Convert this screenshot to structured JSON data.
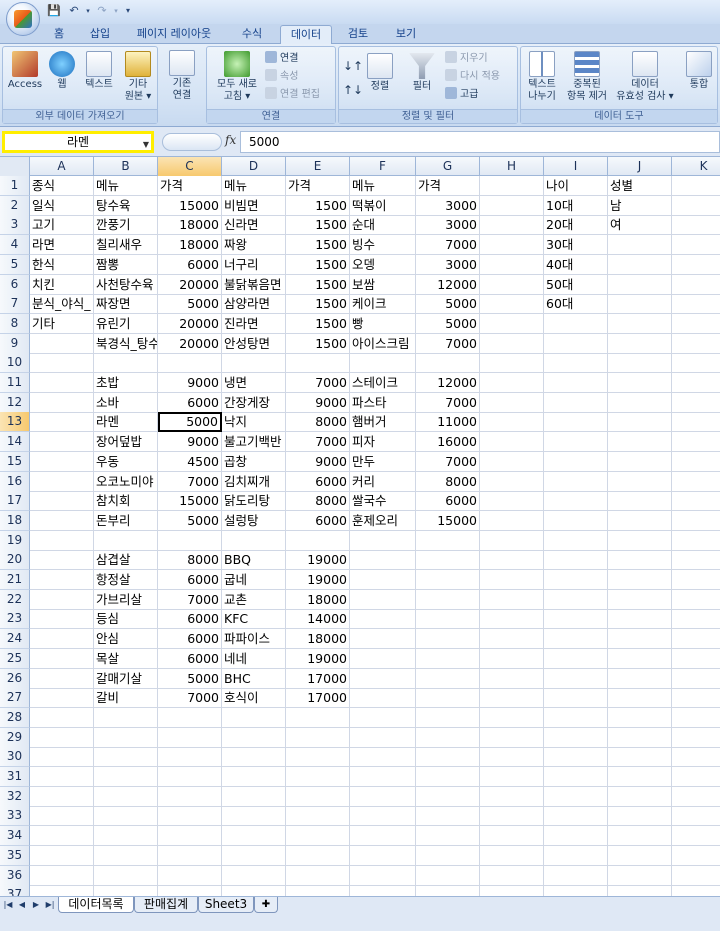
{
  "ribbon_tabs": [
    "홈",
    "삽입",
    "페이지 레이아웃",
    "수식",
    "데이터",
    "검토",
    "보기"
  ],
  "active_tab": "데이터",
  "groups": {
    "external": {
      "label": "외부 데이터 가져오기",
      "buttons": [
        "Access",
        "웹",
        "텍스트",
        "기타",
        "원본 ▾"
      ]
    },
    "existing": {
      "line1": "기존",
      "line2": "연결"
    },
    "connections": {
      "label": "연결",
      "refresh1": "모두 새로",
      "refresh2": "고침 ▾",
      "connect": "연결",
      "properties": "속성",
      "edit_links": "연결 편집"
    },
    "sortfilter": {
      "label": "정렬 및 필터",
      "sort": "정렬",
      "filter": "필터",
      "clear": "지우기",
      "reapply": "다시 적용",
      "advanced": "고급"
    },
    "datatools": {
      "label": "데이터 도구",
      "text1": "텍스트",
      "text2": "나누기",
      "dup1": "중복된",
      "dup2": "항목 제거",
      "valid1": "데이터",
      "valid2": "유효성 검사 ▾",
      "consolidate": "통합"
    }
  },
  "formula_bar": {
    "name_box": "라멘",
    "fx": "fx",
    "value": "5000"
  },
  "columns": [
    "A",
    "B",
    "C",
    "D",
    "E",
    "F",
    "G",
    "H",
    "I",
    "J",
    "K"
  ],
  "selected_cell": {
    "col": "C",
    "row": 13
  },
  "rows": [
    {
      "n": 1,
      "A": "종식",
      "B": "메뉴",
      "C": "가격",
      "D": "메뉴",
      "E": "가격",
      "F": "메뉴",
      "G": "가격",
      "I": "나이",
      "J": "성별"
    },
    {
      "n": 2,
      "A": "일식",
      "B": "탕수육",
      "C": "15000",
      "D": "비빔면",
      "E": "1500",
      "F": "떡볶이",
      "G": "3000",
      "I": "10대",
      "J": "남"
    },
    {
      "n": 3,
      "A": "고기",
      "B": "깐풍기",
      "C": "18000",
      "D": "신라면",
      "E": "1500",
      "F": "순대",
      "G": "3000",
      "I": "20대",
      "J": "여"
    },
    {
      "n": 4,
      "A": "라면",
      "B": "칠리새우",
      "C": "18000",
      "D": "짜왕",
      "E": "1500",
      "F": "빙수",
      "G": "7000",
      "I": "30대"
    },
    {
      "n": 5,
      "A": "한식",
      "B": "짬뽕",
      "C": "6000",
      "D": "너구리",
      "E": "1500",
      "F": "오뎅",
      "G": "3000",
      "I": "40대"
    },
    {
      "n": 6,
      "A": "치킨",
      "B": "사천탕수육",
      "C": "20000",
      "D": "불닭볶음면",
      "E": "1500",
      "F": "보쌈",
      "G": "12000",
      "I": "50대"
    },
    {
      "n": 7,
      "A": "분식_야식_",
      "B": "짜장면",
      "C": "5000",
      "D": "삼양라면",
      "E": "1500",
      "F": "케이크",
      "G": "5000",
      "I": "60대"
    },
    {
      "n": 8,
      "A": "기타",
      "B": "유린기",
      "C": "20000",
      "D": "진라면",
      "E": "1500",
      "F": "빵",
      "G": "5000"
    },
    {
      "n": 9,
      "B": "북경식_탕수",
      "C": "20000",
      "D": "안성탕면",
      "E": "1500",
      "F": "아이스크림",
      "G": "7000"
    },
    {
      "n": 10
    },
    {
      "n": 11,
      "B": "초밥",
      "C": "9000",
      "D": "냉면",
      "E": "7000",
      "F": "스테이크",
      "G": "12000"
    },
    {
      "n": 12,
      "B": "소바",
      "C": "6000",
      "D": "간장게장",
      "E": "9000",
      "F": "파스타",
      "G": "7000"
    },
    {
      "n": 13,
      "B": "라멘",
      "C": "5000",
      "D": "낙지",
      "E": "8000",
      "F": "햄버거",
      "G": "11000"
    },
    {
      "n": 14,
      "B": "장어덮밥",
      "C": "9000",
      "D": "불고기백반",
      "E": "7000",
      "F": "피자",
      "G": "16000"
    },
    {
      "n": 15,
      "B": "우동",
      "C": "4500",
      "D": "곱창",
      "E": "9000",
      "F": "만두",
      "G": "7000"
    },
    {
      "n": 16,
      "B": "오코노미야",
      "C": "7000",
      "D": "김치찌개",
      "E": "6000",
      "F": "커리",
      "G": "8000"
    },
    {
      "n": 17,
      "B": "참치회",
      "C": "15000",
      "D": "닭도리탕",
      "E": "8000",
      "F": "쌀국수",
      "G": "6000"
    },
    {
      "n": 18,
      "B": "돈부리",
      "C": "5000",
      "D": "설렁탕",
      "E": "6000",
      "F": "훈제오리",
      "G": "15000"
    },
    {
      "n": 19
    },
    {
      "n": 20,
      "B": "삼겹살",
      "C": "8000",
      "D": "BBQ",
      "E": "19000"
    },
    {
      "n": 21,
      "B": "항정살",
      "C": "6000",
      "D": "굽네",
      "E": "19000"
    },
    {
      "n": 22,
      "B": "가브리살",
      "C": "7000",
      "D": "교촌",
      "E": "18000"
    },
    {
      "n": 23,
      "B": "등심",
      "C": "6000",
      "D": "KFC",
      "E": "14000"
    },
    {
      "n": 24,
      "B": "안심",
      "C": "6000",
      "D": "파파이스",
      "E": "18000"
    },
    {
      "n": 25,
      "B": "목살",
      "C": "6000",
      "D": "네네",
      "E": "19000"
    },
    {
      "n": 26,
      "B": "갈매기살",
      "C": "5000",
      "D": "BHC",
      "E": "17000"
    },
    {
      "n": 27,
      "B": "갈비",
      "C": "7000",
      "D": "호식이",
      "E": "17000"
    },
    {
      "n": 28
    },
    {
      "n": 29
    },
    {
      "n": 30
    },
    {
      "n": 31
    },
    {
      "n": 32
    },
    {
      "n": 33
    },
    {
      "n": 34
    },
    {
      "n": 35
    },
    {
      "n": 36
    },
    {
      "n": 37
    }
  ],
  "sheet_tabs": [
    {
      "label": "데이터목록",
      "active": true
    },
    {
      "label": "판매집계",
      "active": false
    },
    {
      "label": "Sheet3",
      "active": false
    }
  ]
}
